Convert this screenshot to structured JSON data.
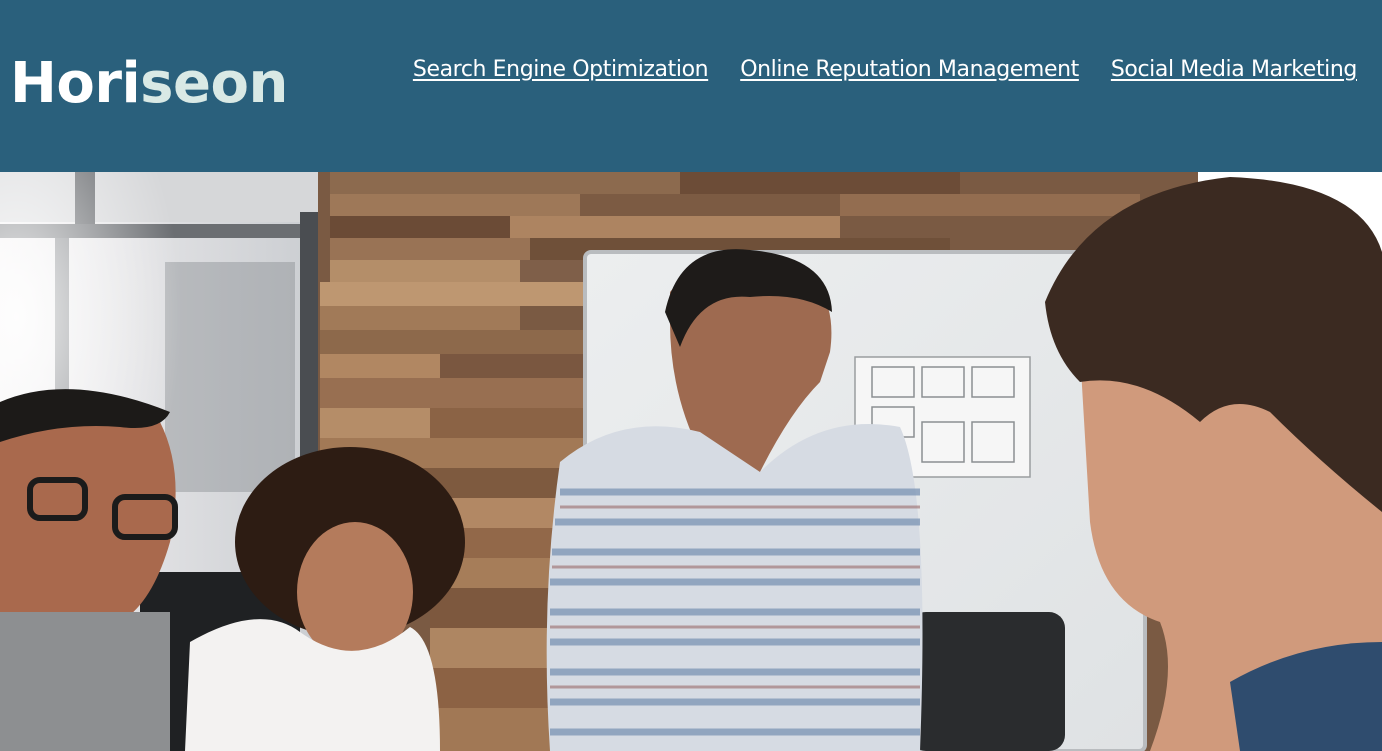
{
  "header": {
    "logo_part1": "Hori",
    "logo_part2": "seon"
  },
  "nav": {
    "items": [
      {
        "label": "Search Engine Optimization"
      },
      {
        "label": "Online Reputation Management"
      },
      {
        "label": "Social Media Marketing"
      }
    ]
  },
  "colors": {
    "header_bg": "#2a607c",
    "logo_accent": "#d9e9e5",
    "link": "#ffffff"
  },
  "hero": {
    "image": "team-meeting-photo"
  }
}
